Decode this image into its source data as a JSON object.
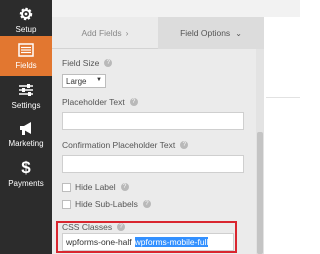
{
  "sidebar": {
    "items": [
      {
        "label": "Setup",
        "icon": "gear-icon",
        "active": false
      },
      {
        "label": "Fields",
        "icon": "list-icon",
        "active": true
      },
      {
        "label": "Settings",
        "icon": "sliders-icon",
        "active": false
      },
      {
        "label": "Marketing",
        "icon": "megaphone-icon",
        "active": false
      },
      {
        "label": "Payments",
        "icon": "dollar-icon",
        "active": false
      }
    ],
    "active_color": "#e27730",
    "bg_color": "#2c2c2c"
  },
  "tabs": {
    "add_fields": "Add Fields",
    "add_fields_chevron": "›",
    "field_options": "Field Options",
    "field_options_chevron": "⌄"
  },
  "field_size": {
    "label": "Field Size",
    "value": "Large"
  },
  "placeholder_text": {
    "label": "Placeholder Text",
    "value": ""
  },
  "confirmation_placeholder": {
    "label": "Confirmation Placeholder Text",
    "value": ""
  },
  "hide_label": {
    "label": "Hide Label",
    "checked": false
  },
  "hide_sublabels": {
    "label": "Hide Sub-Labels",
    "checked": false
  },
  "css_classes": {
    "label": "CSS Classes",
    "value_plain": "wpforms-one-half",
    "value_selected": "wpforms-mobile-full"
  },
  "highlight_color": "#d9262f"
}
